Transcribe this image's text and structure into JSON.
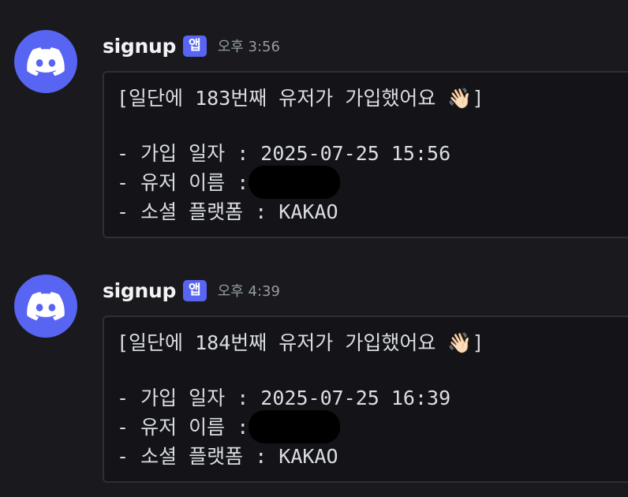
{
  "messages": [
    {
      "username": "signup",
      "badge": "앱",
      "time": "오후 3:56",
      "title_line": "[일단에 183번째 유저가 가입했어요 👋🏻]",
      "join_date_line": "- 가입 일자 : 2025-07-25 15:56",
      "user_name_line": "- 유저 이름 :",
      "social_line": "- 소셜 플랫폼 : KAKAO"
    },
    {
      "username": "signup",
      "badge": "앱",
      "time": "오후 4:39",
      "title_line": "[일단에 184번째 유저가 가입했어요 👋🏻]",
      "join_date_line": "- 가입 일자 : 2025-07-25 16:39",
      "user_name_line": "- 유저 이름 :",
      "social_line": "- 소셜 플랫폼 : KAKAO"
    }
  ],
  "colors": {
    "background": "#1a1a1e",
    "brand": "#5865f2",
    "codeblock_bg": "#131318",
    "timestamp": "#949ba4"
  },
  "icons": {
    "avatar": "discord-logo-icon"
  }
}
